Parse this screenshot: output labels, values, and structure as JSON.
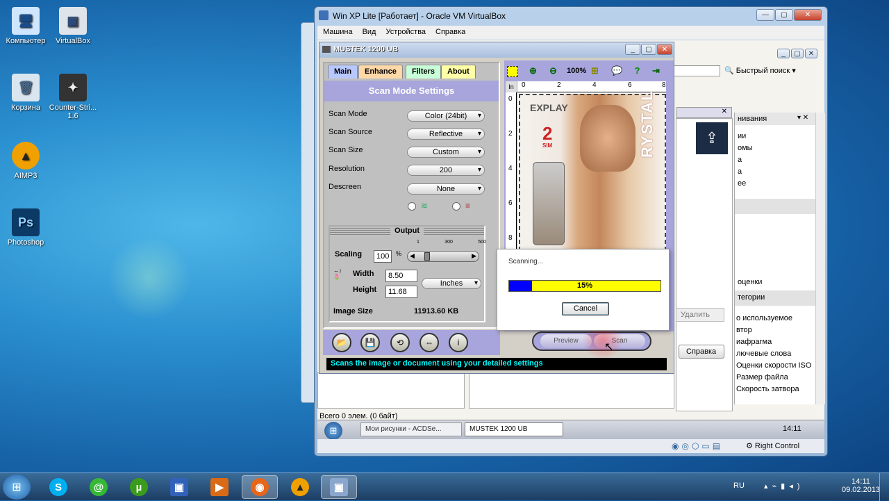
{
  "desktop": {
    "icons": [
      {
        "label": "Компьютер",
        "icon": "computer-icon"
      },
      {
        "label": "VirtualBox",
        "icon": "virtualbox-icon"
      },
      {
        "label": "Корзина",
        "icon": "recycle-bin-icon"
      },
      {
        "label": "Counter-Stri... 1.6",
        "icon": "counter-strike-icon"
      },
      {
        "label": "AIMP3",
        "icon": "aimp-icon"
      },
      {
        "label": "Photoshop",
        "icon": "photoshop-icon"
      }
    ]
  },
  "vbox": {
    "title": "Win XP Lite [Работает] - Oracle VM VirtualBox",
    "menu": [
      "Машина",
      "Вид",
      "Устройства",
      "Справка"
    ],
    "status_right": "Right Control"
  },
  "guest": {
    "statusbar": "Всего 0 элем.  (0 байт)",
    "taskbar_items": [
      "Мои рисунки - ACDSe...",
      "MUSTEK 1200 UB"
    ],
    "clock": "14:11",
    "search_placeholder": "Быстрый поиск",
    "delete_button": "Удалить",
    "help_button": "Справка",
    "right_panel_header": "нивания",
    "right_panel_items": [
      "ии",
      "омы",
      "а",
      "а",
      "ее"
    ],
    "right_panel_lower": [
      "оценки"
    ],
    "categories_header": "тегории",
    "categories": [
      "о используемое",
      "втор",
      "иафрагма",
      "лючевые слова",
      "Оценки скорости ISO",
      "Размер файла",
      "Скорость затвора"
    ]
  },
  "mustek": {
    "title": "MUSTEK 1200 UB",
    "tabs": [
      "Main",
      "Enhance",
      "Filters",
      "About"
    ],
    "section_title": "Scan Mode Settings",
    "settings": [
      {
        "label": "Scan Mode",
        "value": "Color (24bit)"
      },
      {
        "label": "Scan Source",
        "value": "Reflective"
      },
      {
        "label": "Scan Size",
        "value": "Custom"
      },
      {
        "label": "Resolution",
        "value": "200"
      },
      {
        "label": "Descreen",
        "value": "None"
      }
    ],
    "output": {
      "title": "Output",
      "scaling_label": "Scaling",
      "scaling_value": "100",
      "scaling_unit": "%",
      "slider_ticks": [
        "1",
        "300",
        "500"
      ],
      "width_label": "Width",
      "width_value": "8.50",
      "height_label": "Height",
      "height_value": "11.68",
      "units": "Inches",
      "image_size_label": "Image Size",
      "image_size_value": "11913.60 KB"
    },
    "zoom_label": "100%",
    "ruler_unit": "In",
    "ruler_top": [
      "0",
      "2",
      "4",
      "6",
      "8"
    ],
    "ruler_left": [
      "0",
      "2",
      "4",
      "6",
      "8"
    ],
    "preview_label": "Preview",
    "scan_label": "Scan",
    "hint": "Scans the image or document using your detailed settings",
    "preview_brand": "EXPLAY",
    "preview_text": "RYSTAL",
    "preview_sim": "2",
    "preview_sim_label": "SIM"
  },
  "dialog": {
    "title": "Scanning...",
    "progress": 15,
    "progress_text": "15%",
    "cancel": "Cancel"
  },
  "host_taskbar": {
    "lang": "RU",
    "time": "14:11",
    "date": "09.02.2013"
  },
  "colors": {
    "title_bar_purple": "#a7a5dc",
    "progress_blue": "#0000ff",
    "progress_yellow": "#ffff00",
    "hint_text": "#00ffff"
  }
}
